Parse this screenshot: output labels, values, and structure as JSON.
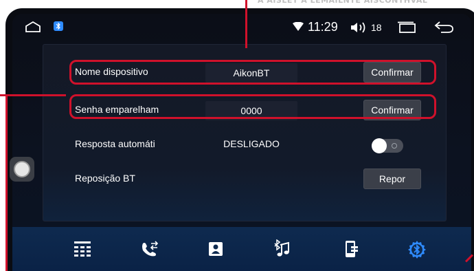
{
  "banner": {
    "text": "A AISLET A LEMAILNTE AISCONTHVAL"
  },
  "status_bar": {
    "time": "11:29",
    "volume_level": "18"
  },
  "settings": {
    "device_name": {
      "label": "Nome dispositivo",
      "value": "AikonBT",
      "button": "Confirmar"
    },
    "pairing_password": {
      "label": "Senha emparelham",
      "value": "0000",
      "button": "Confirmar"
    },
    "auto_answer": {
      "label": "Resposta automáti",
      "value": "DESLIGADO",
      "enabled": false
    },
    "bt_reset": {
      "label": "Reposição BT",
      "button": "Repor"
    }
  },
  "bottom_nav": {
    "items": [
      {
        "icon": "dialpad-icon"
      },
      {
        "icon": "call-log-icon"
      },
      {
        "icon": "contacts-icon"
      },
      {
        "icon": "bt-music-icon"
      },
      {
        "icon": "phone-device-icon"
      },
      {
        "icon": "bluetooth-settings-icon",
        "active": true
      }
    ]
  },
  "colors": {
    "highlight": "#d0112b",
    "accent_blue": "#2e8bff",
    "panel_bg": "#141926",
    "button_bg": "#3b3f49"
  }
}
